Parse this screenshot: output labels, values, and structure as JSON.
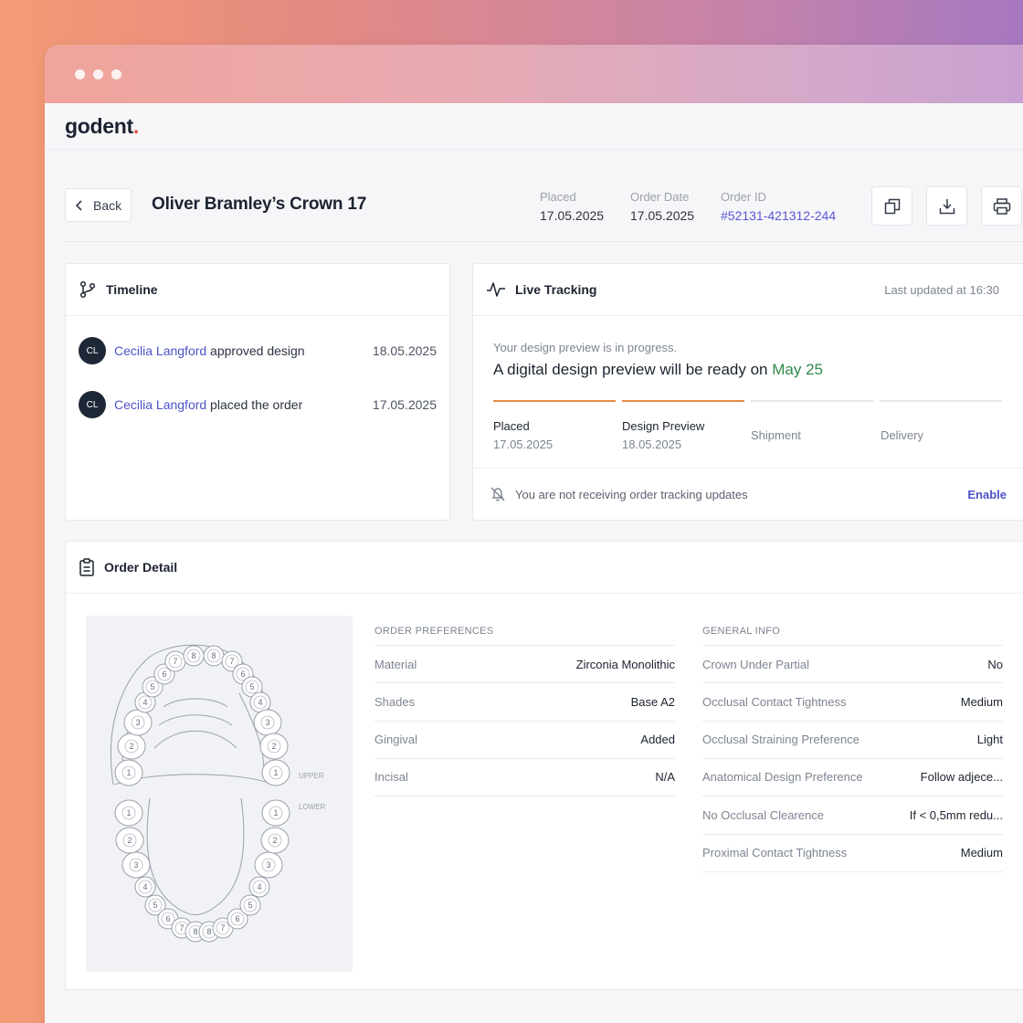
{
  "app": {
    "logo": "godent",
    "logo_dot": "."
  },
  "header": {
    "back_label": "Back",
    "title": "Oliver Bramley’s Crown 17",
    "meta": [
      {
        "label": "Placed",
        "value": "17.05.2025"
      },
      {
        "label": "Order Date",
        "value": "17.05.2025"
      },
      {
        "label": "Order ID",
        "value": "#52131-421312-244"
      }
    ],
    "icons": [
      "copy-icon",
      "download-icon",
      "print-icon"
    ]
  },
  "timeline": {
    "title": "Timeline",
    "items": [
      {
        "initials": "CL",
        "name": "Cecilia Langford",
        "action": " approved design",
        "date": "18.05.2025"
      },
      {
        "initials": "CL",
        "name": "Cecilia Langford",
        "action": " placed the order",
        "date": "17.05.2025"
      }
    ]
  },
  "tracking": {
    "title": "Live Tracking",
    "updated": "Last updated at 16:30",
    "subtitle": "Your design preview is in progress.",
    "main_prefix": "A digital design preview will be ready on ",
    "main_highlight": "May 25",
    "steps": [
      {
        "label": "Placed",
        "date": "17.05.2025",
        "done": true
      },
      {
        "label": "Design Preview",
        "date": "18.05.2025",
        "done": true
      },
      {
        "label": "Shipment",
        "date": "",
        "done": false
      },
      {
        "label": "Delivery",
        "date": "",
        "done": false
      }
    ],
    "notice": "You are not receiving order tracking updates",
    "enable_label": "Enable"
  },
  "order_detail": {
    "title": "Order Detail",
    "chart_labels": {
      "upper": "UPPER",
      "lower": "LOWER"
    },
    "preferences": {
      "title": "ORDER PREFERENCES",
      "rows": [
        {
          "key": "Material",
          "value": "Zirconia Monolithic"
        },
        {
          "key": "Shades",
          "value": "Base A2"
        },
        {
          "key": "Gingival",
          "value": "Added"
        },
        {
          "key": "Incisal",
          "value": "N/A"
        }
      ]
    },
    "general": {
      "title": "GENERAL INFO",
      "rows": [
        {
          "key": "Crown Under Partial",
          "value": "No"
        },
        {
          "key": "Occlusal Contact Tightness",
          "value": "Medium"
        },
        {
          "key": "Occlusal Straining Preference",
          "value": "Light"
        },
        {
          "key": "Anatomical Design Preference",
          "value": "Follow adjece..."
        },
        {
          "key": "No Occlusal Clearence",
          "value": "If < 0,5mm redu..."
        },
        {
          "key": "Proximal Contact Tightness",
          "value": "Medium"
        }
      ]
    },
    "upper_teeth": [
      "1",
      "2",
      "3",
      "4",
      "5",
      "6",
      "7",
      "8",
      "8",
      "7",
      "6",
      "5",
      "4",
      "3",
      "2",
      "1"
    ],
    "lower_teeth": [
      "1",
      "2",
      "3",
      "4",
      "5",
      "6",
      "7",
      "8",
      "8",
      "7",
      "6",
      "5",
      "4",
      "3",
      "2",
      "1"
    ]
  },
  "colors": {
    "accent": "#4b53c8",
    "progress": "#e88a4a",
    "highlight": "#2f8a4a",
    "brand_dot": "#e5493a"
  }
}
